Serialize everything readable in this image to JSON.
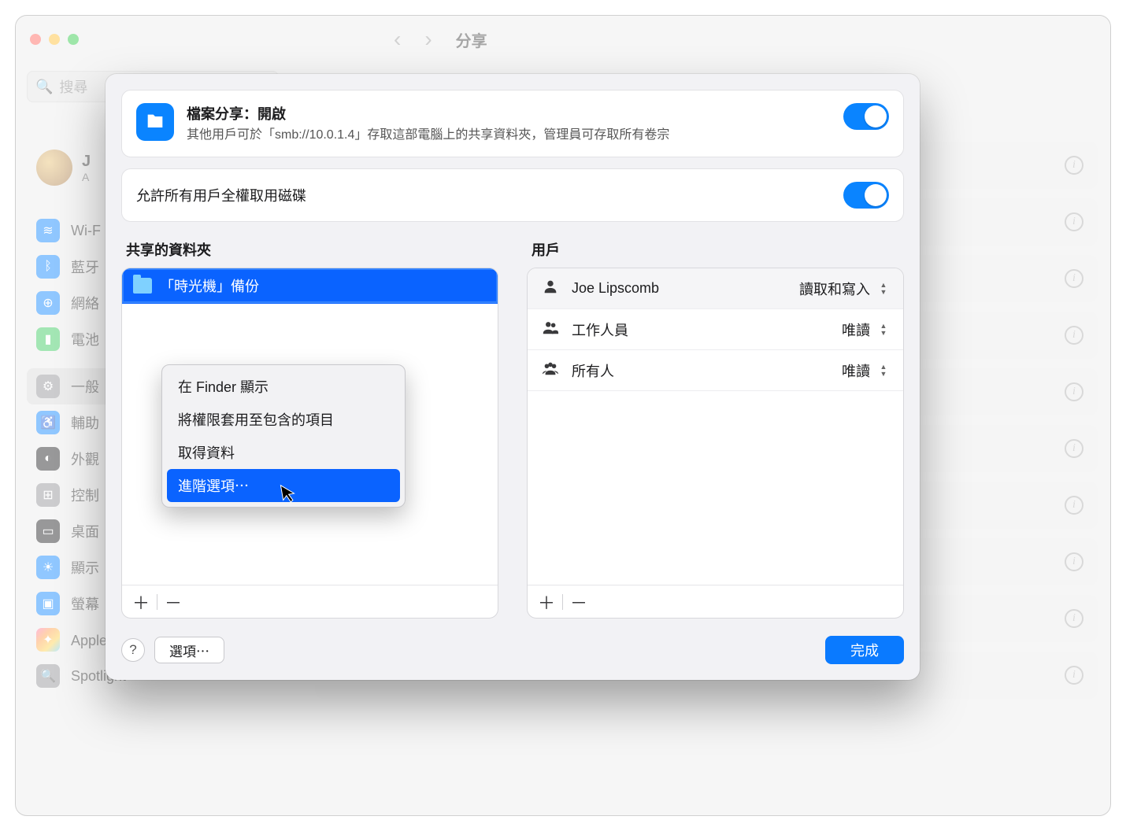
{
  "window": {
    "title": "分享",
    "search_placeholder": "搜尋"
  },
  "backdrop": {
    "user_initial": "J",
    "user_sub": "A",
    "sidebar_items": [
      {
        "label": "Wi-F"
      },
      {
        "label": "藍牙"
      },
      {
        "label": "網絡"
      },
      {
        "label": "電池"
      },
      {
        "label": "一般"
      },
      {
        "label": "輔助"
      },
      {
        "label": "外觀"
      },
      {
        "label": "控制"
      },
      {
        "label": "桌面"
      },
      {
        "label": "顯示"
      },
      {
        "label": "螢幕"
      },
      {
        "label": "Apple Intelligence 與 Siri"
      },
      {
        "label": "Spotlight"
      }
    ]
  },
  "sheet": {
    "file_sharing": {
      "title": "檔案分享：開啟",
      "subtitle": "其他用戶可於「smb://10.0.1.4」存取這部電腦上的共享資料夾，管理員可存取所有卷宗",
      "enabled": true
    },
    "full_disk": {
      "label": "允許所有用戶全權取用磁碟",
      "enabled": true
    },
    "folders_header": "共享的資料夾",
    "users_header": "用戶",
    "folders": [
      {
        "name": "「時光機」備份"
      }
    ],
    "users": [
      {
        "icon": "person",
        "name": "Joe Lipscomb",
        "perm": "讀取和寫入"
      },
      {
        "icon": "people2",
        "name": "工作人員",
        "perm": "唯讀"
      },
      {
        "icon": "people3",
        "name": "所有人",
        "perm": "唯讀"
      }
    ],
    "context_menu": [
      "在 Finder 顯示",
      "將權限套用至包含的項目",
      "取得資料",
      "進階選項⋯"
    ],
    "context_highlight_index": 3,
    "footer": {
      "help": "?",
      "options": "選項⋯",
      "done": "完成"
    }
  }
}
